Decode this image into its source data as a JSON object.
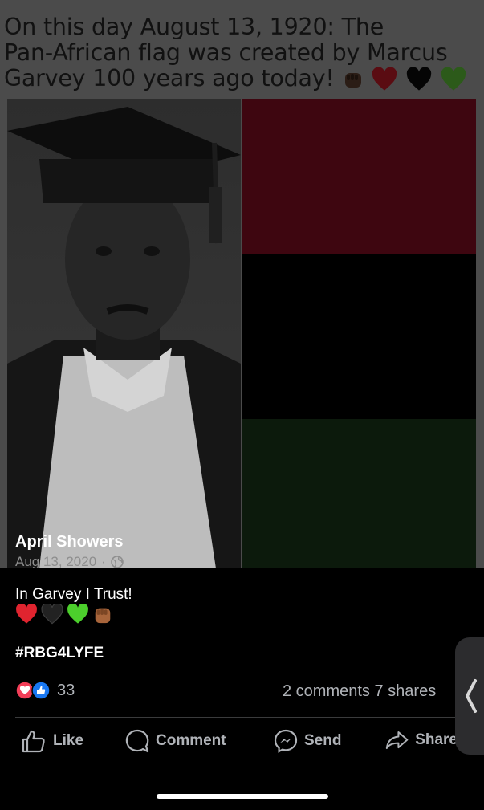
{
  "headline": {
    "line1": "On this day August 13, 1920: The",
    "line2": "Pan-African flag was created by Marcus",
    "line3": "Garvey 100 years ago today!",
    "emojis": [
      "fist-icon",
      "red-heart-icon",
      "black-heart-icon",
      "green-heart-icon"
    ]
  },
  "flag": {
    "red": "#3e0610",
    "black": "#000000",
    "green": "#0c1a0c"
  },
  "post": {
    "author": "April Showers",
    "date": "Aug 13, 2020",
    "separator": "·",
    "caption": "In Garvey I Trust!",
    "caption_emojis": [
      "red-heart-icon",
      "black-heart-icon",
      "green-heart-icon",
      "fist-icon"
    ],
    "hashtag": "#RBG4LYFE",
    "reaction_count": "33",
    "stats": "2 comments  7 shares"
  },
  "actions": {
    "like": "Like",
    "comment": "Comment",
    "send": "Send",
    "share": "Share"
  },
  "colors": {
    "background": "#000000",
    "muted_text": "#b0b3b8",
    "like_blue": "#1877f2",
    "love_red": "#f33e58"
  }
}
